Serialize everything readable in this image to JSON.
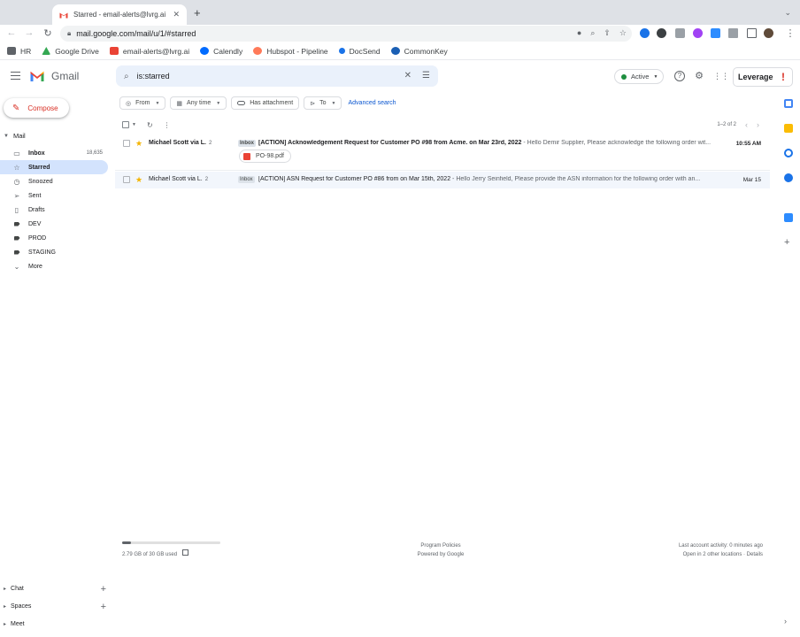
{
  "browser": {
    "tab_title": "Starred - email-alerts@lvrg.ai",
    "tab_close": "✕",
    "new_tab": "+",
    "url": "mail.google.com/mail/u/1/#starred",
    "bookmarks": [
      {
        "label": "HR",
        "color": "#5f6368"
      },
      {
        "label": "Google Drive",
        "color": "#34a853"
      },
      {
        "label": "email-alerts@lvrg.ai",
        "color": "#ea4335"
      },
      {
        "label": "Calendly",
        "color": "#006bff"
      },
      {
        "label": "Hubspot - Pipeline",
        "color": "#ff7a59"
      },
      {
        "label": "DocSend",
        "color": "#1a73e8"
      },
      {
        "label": "CommonKey",
        "color": "#1a5fb4"
      }
    ]
  },
  "gmail": {
    "logo_text": "Gmail",
    "search_query": "is:starred",
    "status": "Active",
    "account_name": "Leverage",
    "account_mark": "!",
    "compose_label": "Compose",
    "mail_header": "Mail",
    "nav": [
      {
        "label": "Inbox",
        "icon": "inbox-icon",
        "glyph": "▭",
        "count": "18,635",
        "bold": true
      },
      {
        "label": "Starred",
        "icon": "star-outline-icon",
        "glyph": "☆",
        "count": "",
        "selected": true
      },
      {
        "label": "Snoozed",
        "icon": "clock-icon",
        "glyph": "◷",
        "count": ""
      },
      {
        "label": "Sent",
        "icon": "send-icon",
        "glyph": "➢",
        "count": ""
      },
      {
        "label": "Drafts",
        "icon": "draft-icon",
        "glyph": "▯",
        "count": ""
      },
      {
        "label": "DEV",
        "icon": "label-icon",
        "glyph": "",
        "count": ""
      },
      {
        "label": "PROD",
        "icon": "label-icon",
        "glyph": "",
        "count": ""
      },
      {
        "label": "STAGING",
        "icon": "label-icon",
        "glyph": "",
        "count": ""
      },
      {
        "label": "More",
        "icon": "chevron-down-icon",
        "glyph": "⌄",
        "count": ""
      }
    ],
    "bottom_sections": [
      "Chat",
      "Spaces",
      "Meet"
    ],
    "filters": [
      {
        "label": "From",
        "icon": "person-icon",
        "glyph": "◎",
        "dropdown": true
      },
      {
        "label": "Any time",
        "icon": "calendar-icon",
        "glyph": "▦",
        "dropdown": true
      },
      {
        "label": "Has attachment",
        "icon": "attachment-icon",
        "glyph": "",
        "dropdown": false
      },
      {
        "label": "To",
        "icon": "send-icon",
        "glyph": "⊳",
        "dropdown": true
      }
    ],
    "advanced_search": "Advanced search",
    "pagination": "1–2 of 2",
    "emails": [
      {
        "sender": "Michael Scott via L.",
        "count": "2",
        "label": "Inbox",
        "subject": "[ACTION] Acknowledgement Request for Customer PO #98 from Acme. on Mar 23rd, 2022",
        "snippet": " - Hello Demir Supplier, Please acknowledge the following order wit...",
        "date": "10:55 AM",
        "attachment": "PO-98.pdf",
        "unread": true
      },
      {
        "sender": "Michael Scott via L.",
        "count": "2",
        "label": "Inbox",
        "subject": "[ACTION] ASN Request for Customer PO #86 from on Mar 15th, 2022",
        "snippet": " - Hello Jerry Seinfield, Please provide the ASN information for the following order with an...",
        "date": "Mar 15",
        "attachment": "",
        "unread": false
      }
    ],
    "footer": {
      "storage_text": "2.79 GB of 30 GB used",
      "storage_fraction": 0.093,
      "program_policies": "Program Policies",
      "powered_by": "Powered by Google",
      "last_activity": "Last account activity: 0 minutes ago",
      "other_locations": "Open in 2 other locations · Details"
    }
  }
}
